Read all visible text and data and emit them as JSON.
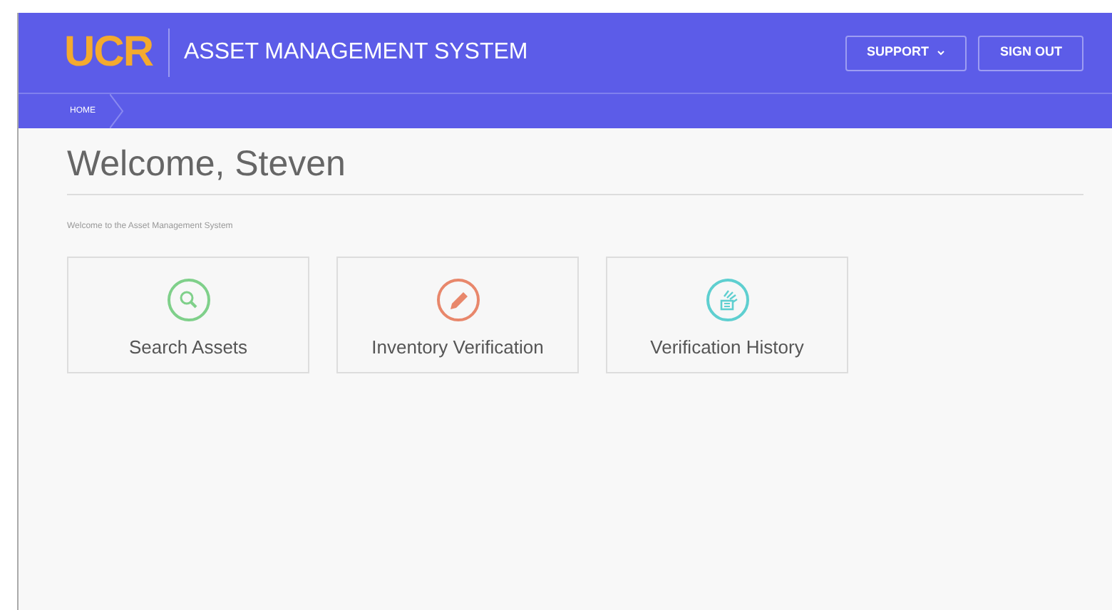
{
  "header": {
    "logo": "UCR",
    "title": "ASSET MANAGEMENT SYSTEM",
    "buttons": [
      {
        "label": "SUPPORT",
        "kind": "dropdown"
      },
      {
        "label": "SIGN OUT",
        "kind": "plain"
      }
    ]
  },
  "breadcrumb": [
    "HOME"
  ],
  "heading": "Welcome, Steven",
  "intro": "Welcome to the Asset Management System",
  "tiles": [
    {
      "label": "Search Assets",
      "kind": "search",
      "color": "#7fd08a"
    },
    {
      "label": "Inventory Verification",
      "kind": "edit",
      "color": "#e8876b"
    },
    {
      "label": "Verification History",
      "kind": "history",
      "color": "#5ecfd0"
    }
  ]
}
